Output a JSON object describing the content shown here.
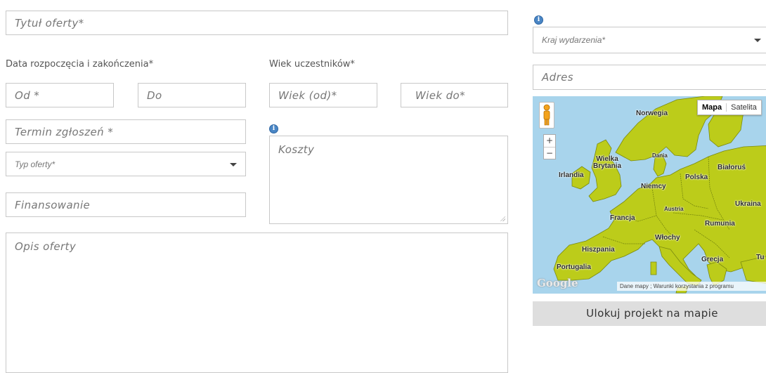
{
  "form": {
    "title_placeholder": "Tytuł oferty*",
    "dates_label": "Data rozpoczęcia i zakończenia*",
    "from_placeholder": "Od *",
    "to_placeholder": "Do",
    "age_label": "Wiek uczestników*",
    "age_from_placeholder": "Wiek (od)*",
    "age_to_placeholder": "Wiek do*",
    "deadline_placeholder": "Termin zgłoszeń *",
    "offer_type_selected": "Typ oferty*",
    "costs_placeholder": "Koszty",
    "financing_placeholder": "Finansowanie",
    "description_placeholder": "Opis oferty",
    "info_symbol": "i"
  },
  "location": {
    "country_selected": "Kraj wydarzenia*",
    "address_placeholder": "Adres",
    "locate_button": "Ulokuj projekt na mapie"
  },
  "map": {
    "type_map": "Mapa",
    "type_satellite": "Satelita",
    "zoom_in": "+",
    "zoom_out": "−",
    "logo": "Google",
    "attribution": "Dane mapy ; Warunki korzystania z programu",
    "labels": {
      "norwegia": "Norwegia",
      "dania": "Dania",
      "wielka_brytania_1": "Wielka",
      "wielka_brytania_2": "Brytania",
      "irlandia": "Irlandia",
      "polska": "Polska",
      "bialorus": "Białoruś",
      "niemcy": "Niemcy",
      "ukraina": "Ukraina",
      "austria": "Austria",
      "francja": "Francja",
      "rumunia": "Rumunia",
      "wlochy": "Włochy",
      "hiszpania": "Hiszpania",
      "portugalia": "Portugalia",
      "grecja": "Grecja",
      "turcja": "Tu"
    },
    "colors": {
      "water": "#a8d4ec",
      "land": "#bccc1a",
      "border": "#7a8a10"
    }
  }
}
